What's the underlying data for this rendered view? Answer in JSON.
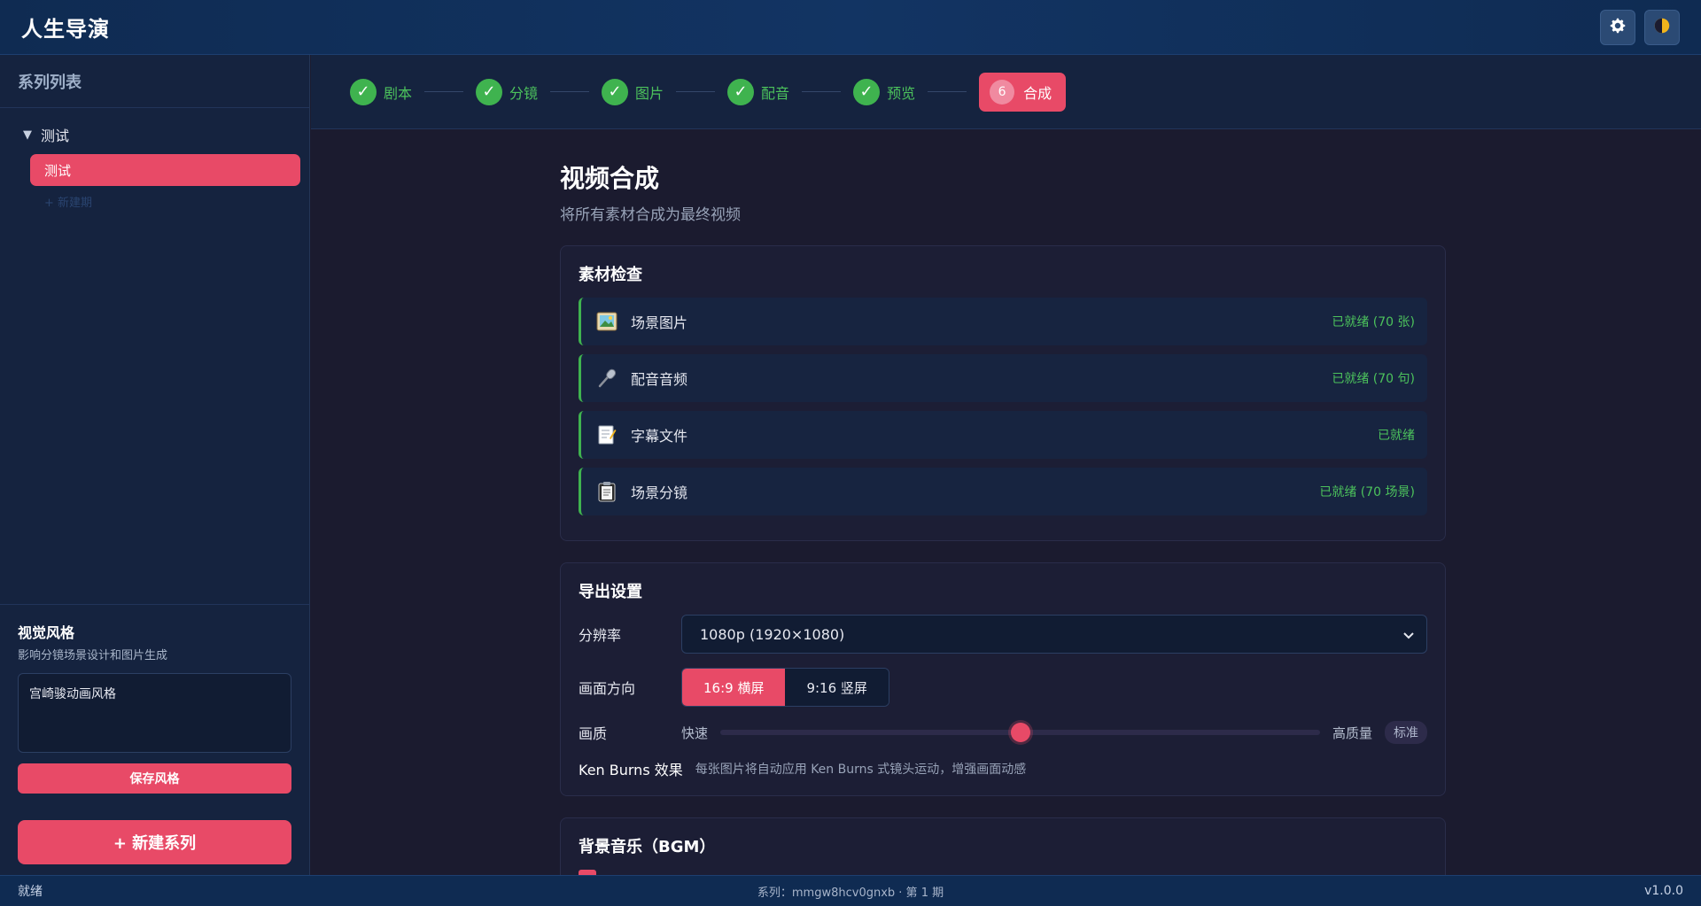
{
  "app": {
    "title": "人生导演"
  },
  "header": {
    "settings_icon": "gear-icon",
    "theme_icon": "theme-toggle-icon"
  },
  "sidebar": {
    "title": "系列列表",
    "series": [
      {
        "name": "测试",
        "expanded": true,
        "episodes": [
          {
            "label": "测试",
            "active": true
          }
        ],
        "new_episode_label": "+ 新建期"
      }
    ],
    "style": {
      "title": "视觉风格",
      "desc": "影响分镜场景设计和图片生成",
      "value": "宫崎骏动画风格",
      "save_label": "保存风格"
    },
    "new_series_label": "+ 新建系列"
  },
  "steps": [
    {
      "label": "剧本",
      "done": true
    },
    {
      "label": "分镜",
      "done": true
    },
    {
      "label": "图片",
      "done": true
    },
    {
      "label": "配音",
      "done": true
    },
    {
      "label": "预览",
      "done": true
    },
    {
      "label": "合成",
      "number": "6",
      "active": true
    }
  ],
  "main": {
    "title": "视频合成",
    "subtitle": "将所有素材合成为最终视频",
    "assets": {
      "title": "素材检查",
      "items": [
        {
          "icon": "image-icon",
          "label": "场景图片",
          "status": "已就绪 (70 张)"
        },
        {
          "icon": "microphone-icon",
          "label": "配音音频",
          "status": "已就绪 (70 句)"
        },
        {
          "icon": "memo-icon",
          "label": "字幕文件",
          "status": "已就绪"
        },
        {
          "icon": "clipboard-icon",
          "label": "场景分镜",
          "status": "已就绪 (70 场景)"
        }
      ]
    },
    "export": {
      "title": "导出设置",
      "resolution_label": "分辨率",
      "resolution_value": "1080p (1920×1080)",
      "orientation_label": "画面方向",
      "orientation_options": [
        "16:9 横屏",
        "9:16 竖屏"
      ],
      "orientation_selected": "16:9 横屏",
      "quality_label": "画质",
      "quality_min_label": "快速",
      "quality_max_label": "高质量",
      "quality_level": 0.5,
      "quality_badge": "标准",
      "kenburns_label": "Ken Burns 效果",
      "kenburns_desc": "每张图片将自动应用 Ken Burns 式镜头运动，增强画面动感"
    },
    "bgm": {
      "title": "背景音乐（BGM）"
    }
  },
  "statusbar": {
    "left": "就绪",
    "center": "系列：mmgw8hcv0gnxb · 第 1 期",
    "right": "v1.0.0"
  },
  "colors": {
    "accent": "#e84a67",
    "success": "#3fb34f",
    "header_bg": "#0f2b52"
  }
}
